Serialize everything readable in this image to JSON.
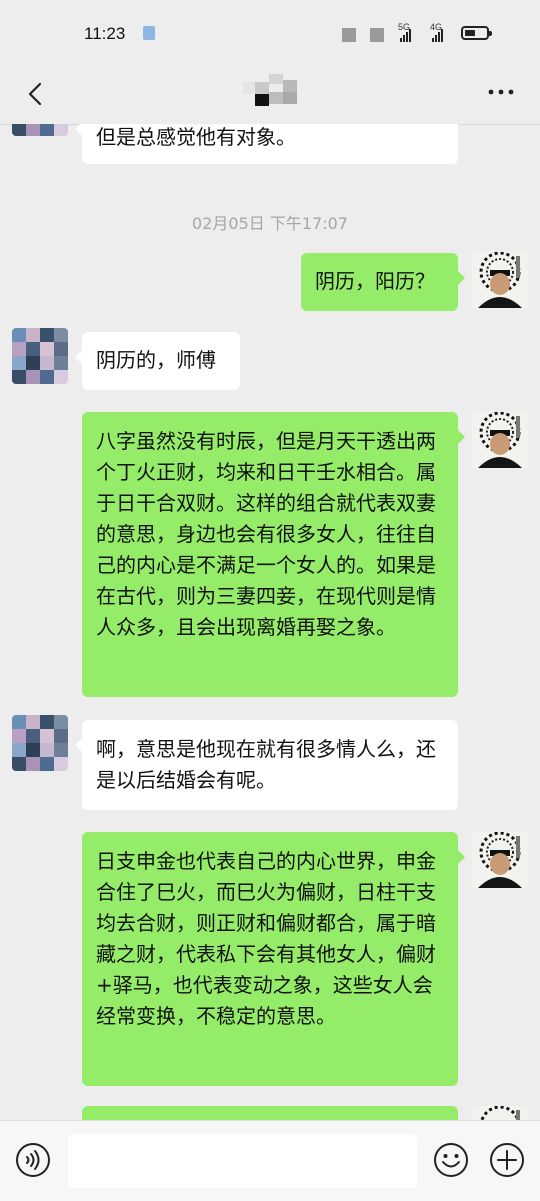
{
  "status_bar": {
    "time": "11:23",
    "network_5g": "5G",
    "network_4g": "4G"
  },
  "nav": {
    "back_icon": "chevron-left-icon",
    "more_icon": "more-dots-icon"
  },
  "messages": [
    {
      "side": "in",
      "text": "但是总感觉他有对象。"
    },
    {
      "timestamp": "02月05日 下午17:07"
    },
    {
      "side": "out",
      "text": "阴历，阳历？"
    },
    {
      "side": "in",
      "text": "阴历的，师傅"
    },
    {
      "side": "out",
      "text": "八字虽然没有时辰，但是月天干透出两个丁火正财，均来和日干壬水相合。属于日干合双财。这样的组合就代表双妻的意思，身边也会有很多女人，往往自己的内心是不满足一个女人的。如果是在古代，则为三妻四妾，在现代则是情人众多，且会出现离婚再娶之象。"
    },
    {
      "side": "in",
      "text": "啊，意思是他现在就有很多情人么，还是以后结婚会有呢。"
    },
    {
      "side": "out",
      "text": "日支申金也代表自己的内心世界，申金合住了巳火，而巳火为偏财，日柱干支均去合财，则正财和偏财都合，属于暗藏之财，代表私下会有其他女人，偏财+驿马，也代表变动之象，这些女人会经常变换，不稳定的意思。"
    }
  ],
  "input_bar": {
    "placeholder": "",
    "voice_icon": "voice-icon",
    "emoji_icon": "emoji-icon",
    "plus_icon": "plus-icon"
  },
  "colors": {
    "background": "#ededed",
    "outgoing_bubble": "#95ec69",
    "incoming_bubble": "#ffffff",
    "timestamp_text": "#a6a6a6"
  }
}
